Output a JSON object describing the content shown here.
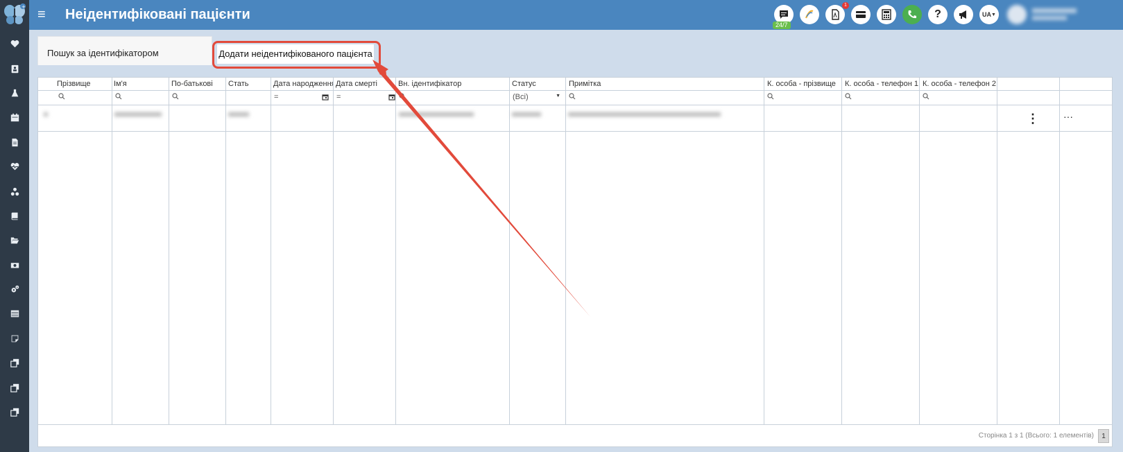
{
  "header": {
    "title": "Неідентифіковані пацієнти",
    "menu_icon": "hamburger-icon",
    "badge_247": "24/7",
    "notification_count": "1",
    "lang": "UA",
    "toolbar_icons": [
      "chat-icon",
      "helsi-icon",
      "pdf-icon",
      "card-icon",
      "calculator-icon",
      "phone-icon",
      "help-icon",
      "megaphone-icon",
      "language-selector"
    ]
  },
  "sidebar": {
    "icons": [
      "heart-icon",
      "contact-card-icon",
      "flask-icon",
      "calendar-icon",
      "document-icon",
      "heartbeat-icon",
      "hierarchy-icon",
      "book-icon",
      "folder-open-icon",
      "money-icon",
      "settings-icon",
      "list-icon",
      "note-icon",
      "copy-icon",
      "copy-icon-2",
      "copy-icon-3"
    ]
  },
  "tabs": {
    "search_tab": "Пошук за ідентифікатором",
    "add_tab": "Додати неідентифікованого пацієнта"
  },
  "table": {
    "columns": [
      "Прізвище",
      "Ім'я",
      "По-батькові",
      "Стать",
      "Дата народження",
      "Дата смерті",
      "Вн. ідентифікатор",
      "Статус",
      "Примітка",
      "К. особа - прізвище",
      "К. особа - телефон 1",
      "К. особа - телефон 2"
    ],
    "status_filter": "(Всі)",
    "filter_equals": "="
  },
  "pager": {
    "text": "Сторінка 1 з 1 (Всього: 1 елементів)",
    "page": "1"
  }
}
